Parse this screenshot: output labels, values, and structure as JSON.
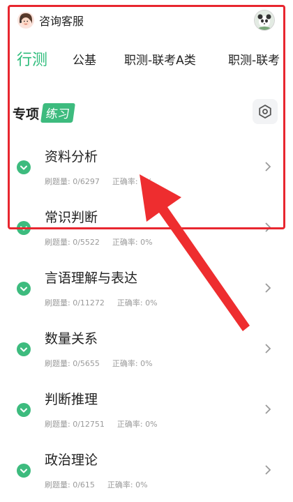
{
  "header": {
    "service_label": "咨询客服",
    "service_icon": "customer-service-icon",
    "avatar_icon": "user-avatar-icon"
  },
  "tabs": [
    {
      "label": "行测",
      "active": true
    },
    {
      "label": "公基",
      "active": false
    },
    {
      "label": "职测-联考A类",
      "active": false
    },
    {
      "label": "职测-联考",
      "active": false
    }
  ],
  "section": {
    "title": "专项",
    "badge": "练习",
    "settings_icon": "settings-icon"
  },
  "categories": [
    {
      "title": "资料分析",
      "count_label": "刷题量: 0/6297",
      "accuracy_label": "正确率: 0%"
    },
    {
      "title": "常识判断",
      "count_label": "刷题量: 0/5522",
      "accuracy_label": "正确率: 0%"
    },
    {
      "title": "言语理解与表达",
      "count_label": "刷题量: 0/11272",
      "accuracy_label": "正确率: 0%"
    },
    {
      "title": "数量关系",
      "count_label": "刷题量: 0/5655",
      "accuracy_label": "正确率: 0%"
    },
    {
      "title": "判断推理",
      "count_label": "刷题量: 0/12751",
      "accuracy_label": "正确率: 0%"
    },
    {
      "title": "政治理论",
      "count_label": "刷题量: 0/615",
      "accuracy_label": "正确率: 0%"
    }
  ],
  "colors": {
    "accent": "#2dbc7b",
    "badge": "#3dbb7e",
    "annotation": "#e8262f"
  }
}
